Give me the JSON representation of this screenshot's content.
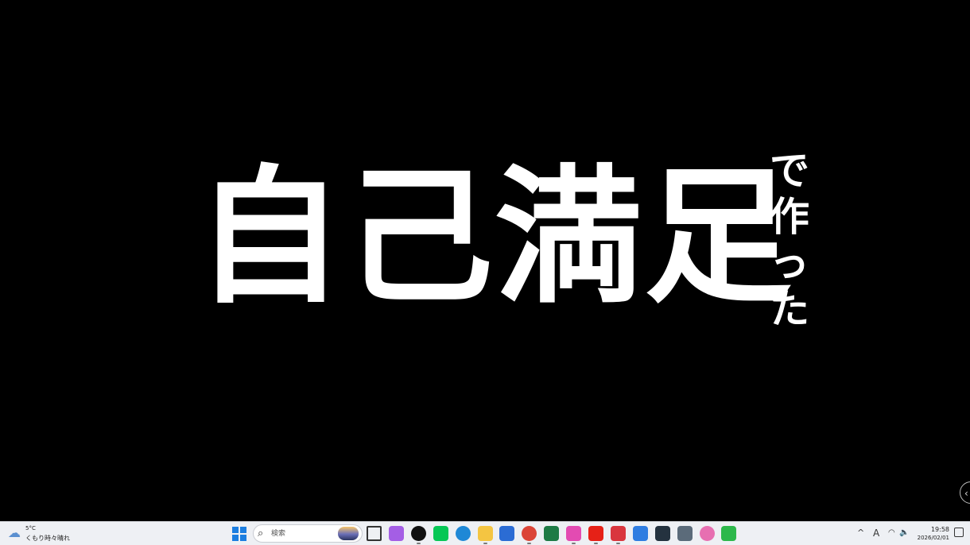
{
  "slide": {
    "title_main": "自己満足",
    "title_side": [
      "で",
      "作",
      "っ",
      "た"
    ]
  },
  "taskbar": {
    "weather": {
      "temp": "5°C",
      "desc": "くもり時々晴れ",
      "icon": "partly-cloudy-icon"
    },
    "search": {
      "label": "検索"
    },
    "apps": [
      {
        "name": "task-view",
        "color": "#333333"
      },
      {
        "name": "copilot",
        "color": "#a45ee5"
      },
      {
        "name": "chatgpt",
        "color": "#111111"
      },
      {
        "name": "line",
        "color": "#06c755"
      },
      {
        "name": "edge",
        "color": "#1e88d6"
      },
      {
        "name": "file-explorer",
        "color": "#f4c542"
      },
      {
        "name": "microsoft-store",
        "color": "#2b6cd4"
      },
      {
        "name": "chrome",
        "color": "#db4437"
      },
      {
        "name": "excel",
        "color": "#1d7a45"
      },
      {
        "name": "itunes",
        "color": "#e34bb2"
      },
      {
        "name": "youtube",
        "color": "#e62117"
      },
      {
        "name": "snipping-tool",
        "color": "#d9363e"
      },
      {
        "name": "browser-app",
        "color": "#2f7de1"
      },
      {
        "name": "media-app",
        "color": "#24323f"
      },
      {
        "name": "calculator",
        "color": "#5b6b7a"
      },
      {
        "name": "photos",
        "color": "#e76fb1"
      },
      {
        "name": "evernote",
        "color": "#2db84b"
      }
    ],
    "tray": {
      "chevron": "^",
      "ime": "A",
      "wifi": "wifi-icon",
      "volume": "speaker-icon"
    },
    "clock": {
      "time": "19:58",
      "date": "2026/02/01"
    }
  }
}
